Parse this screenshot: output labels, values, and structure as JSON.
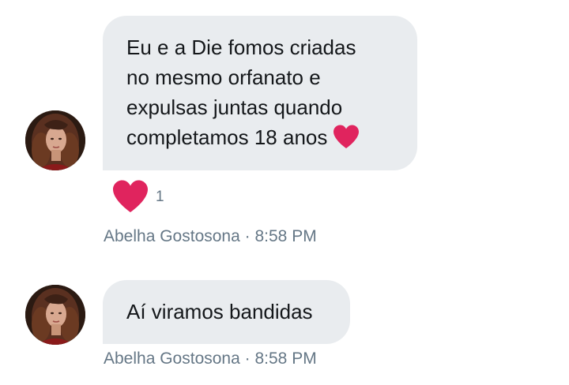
{
  "messages": [
    {
      "lines": [
        "Eu e a Die fomos criadas",
        "no mesmo orfanato e",
        "expulsas juntas quando",
        "completamos 18 anos"
      ],
      "trailing_emoji": "red-heart",
      "reaction": {
        "emoji": "red-heart",
        "count": "1"
      },
      "sender": "Abelha Gostosona",
      "separator": "·",
      "time": "8:58 PM"
    },
    {
      "lines": [
        "Aí viramos bandidas"
      ],
      "sender": "Abelha Gostosona",
      "separator": "·",
      "time": "8:58 PM"
    }
  ],
  "colors": {
    "bubble": "#e9ecef",
    "text": "#14171a",
    "meta": "#657786",
    "heart": "#e0245e"
  }
}
